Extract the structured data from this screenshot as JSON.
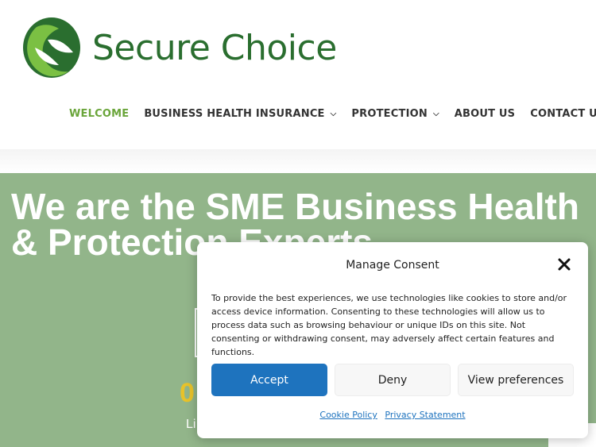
{
  "brand": {
    "name": "Secure Choice",
    "primary_color": "#2a6e2f",
    "accent_color": "#6aa53a",
    "logo_icon": "leaf-swirl-logo"
  },
  "nav": {
    "items": [
      {
        "label": "WELCOME",
        "active": true,
        "has_dropdown": false
      },
      {
        "label": "BUSINESS HEALTH INSURANCE",
        "active": false,
        "has_dropdown": true
      },
      {
        "label": "PROTECTION",
        "active": false,
        "has_dropdown": true
      },
      {
        "label": "ABOUT US",
        "active": false,
        "has_dropdown": false
      },
      {
        "label": "CONTACT US",
        "active": false,
        "has_dropdown": false
      }
    ]
  },
  "hero": {
    "title": "We are the SME Business Health & Protection Experts",
    "partial_number": "0",
    "partial_subtext": "Li",
    "background": "#92b58a"
  },
  "consent": {
    "title": "Manage Consent",
    "body": "To provide the best experiences, we use technologies like cookies to store and/or access device information. Consenting to these technologies will allow us to process data such as browsing behaviour or unique IDs on this site. Not consenting or withdrawing consent, may adversely affect certain features and functions.",
    "accept_label": "Accept",
    "deny_label": "Deny",
    "preferences_label": "View preferences",
    "cookie_policy_label": "Cookie Policy",
    "privacy_statement_label": "Privacy Statement",
    "accept_color": "#1e73be"
  }
}
